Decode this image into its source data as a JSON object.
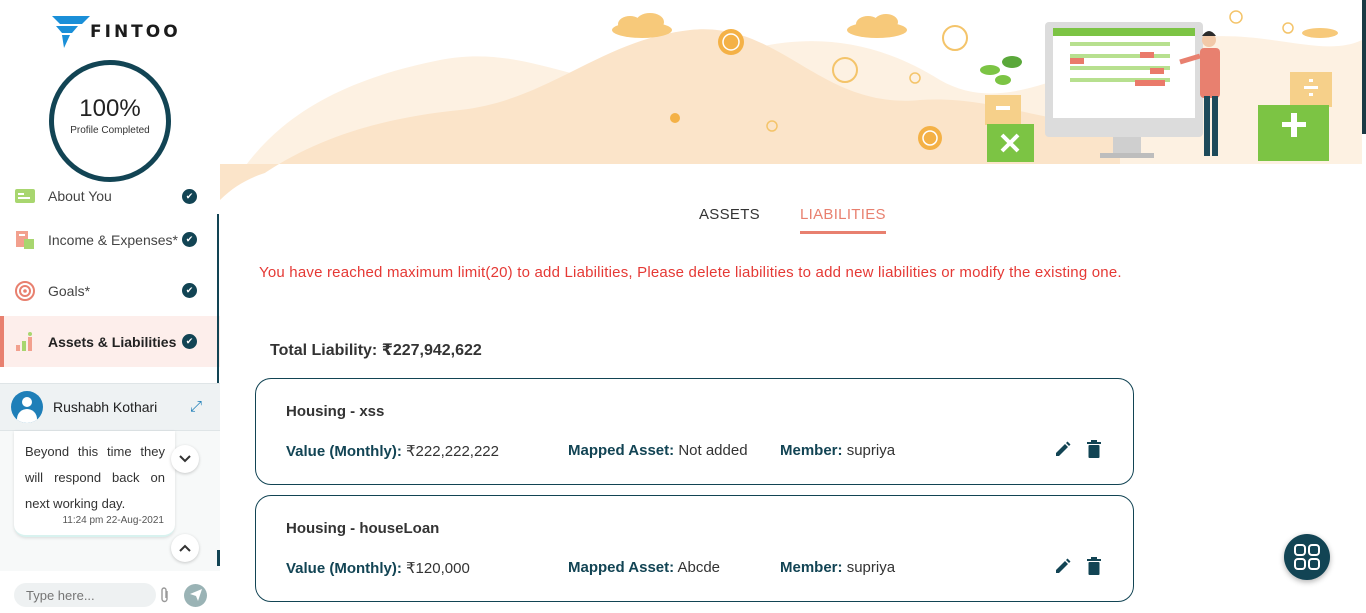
{
  "brand": {
    "name": "FINTOO"
  },
  "profile": {
    "percent": "100%",
    "label": "Profile Completed"
  },
  "sidebar": {
    "items": [
      {
        "label": "About You",
        "icon": "about-you-icon",
        "done": true
      },
      {
        "label": "Income & Expenses*",
        "icon": "income-expenses-icon",
        "done": true
      },
      {
        "label": "Goals*",
        "icon": "goals-icon",
        "done": true
      },
      {
        "label": "Assets & Liabilities",
        "icon": "assets-liabilities-icon",
        "done": true,
        "active": true
      }
    ]
  },
  "chat": {
    "agent_name": "Rushabh Kothari",
    "message": "Beyond this time they will respond back on next working day.",
    "timestamp": "11:24 pm 22-Aug-2021",
    "input_placeholder": "Type here..."
  },
  "tabs": [
    {
      "label": "ASSETS",
      "active": false
    },
    {
      "label": "LIABILITIES",
      "active": true
    }
  ],
  "warning": "You have reached maximum limit(20) to add Liabilities, Please delete liabilities to add new liabilities or modify the existing one.",
  "total": "Total Liability: ₹227,942,622",
  "liabilities": [
    {
      "title": "Housing - xss",
      "value_label": "Value (Monthly):",
      "value": "₹222,222,222",
      "asset_label": "Mapped Asset:",
      "asset": "Not added",
      "member_label": "Member:",
      "member": "supriya"
    },
    {
      "title": "Housing - houseLoan",
      "value_label": "Value (Monthly):",
      "value": "₹120,000",
      "asset_label": "Mapped Asset:",
      "asset": "Abcde",
      "member_label": "Member:",
      "member": "supriya"
    }
  ],
  "colors": {
    "primary": "#124454",
    "accent": "#e8806f",
    "warning": "#e53935",
    "banner": "#fbe7cf"
  }
}
